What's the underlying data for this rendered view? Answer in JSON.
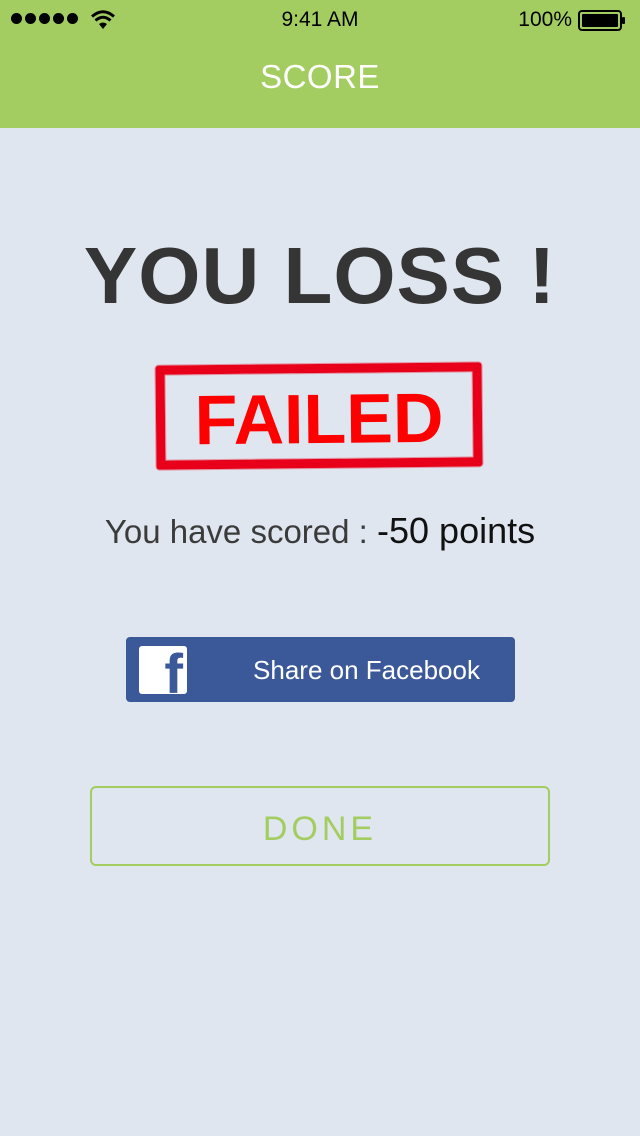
{
  "status_bar": {
    "time": "9:41 AM",
    "battery_percent": "100%",
    "signal_icon": "signal-dots-icon",
    "wifi_icon": "wifi-icon",
    "battery_icon": "battery-icon"
  },
  "nav": {
    "title": "SCORE"
  },
  "result": {
    "headline": "YOU LOSS !",
    "stamp_text": "FAILED",
    "score_label": "You have scored :",
    "score_value": "-50 points"
  },
  "actions": {
    "facebook_icon": "facebook-icon",
    "share_label": "Share on Facebook",
    "done_label": "DONE"
  },
  "colors": {
    "accent": "#a3cd60",
    "background": "#dfe6ef",
    "facebook": "#3b5998",
    "stamp": "#ff0000",
    "headline": "#353535"
  }
}
